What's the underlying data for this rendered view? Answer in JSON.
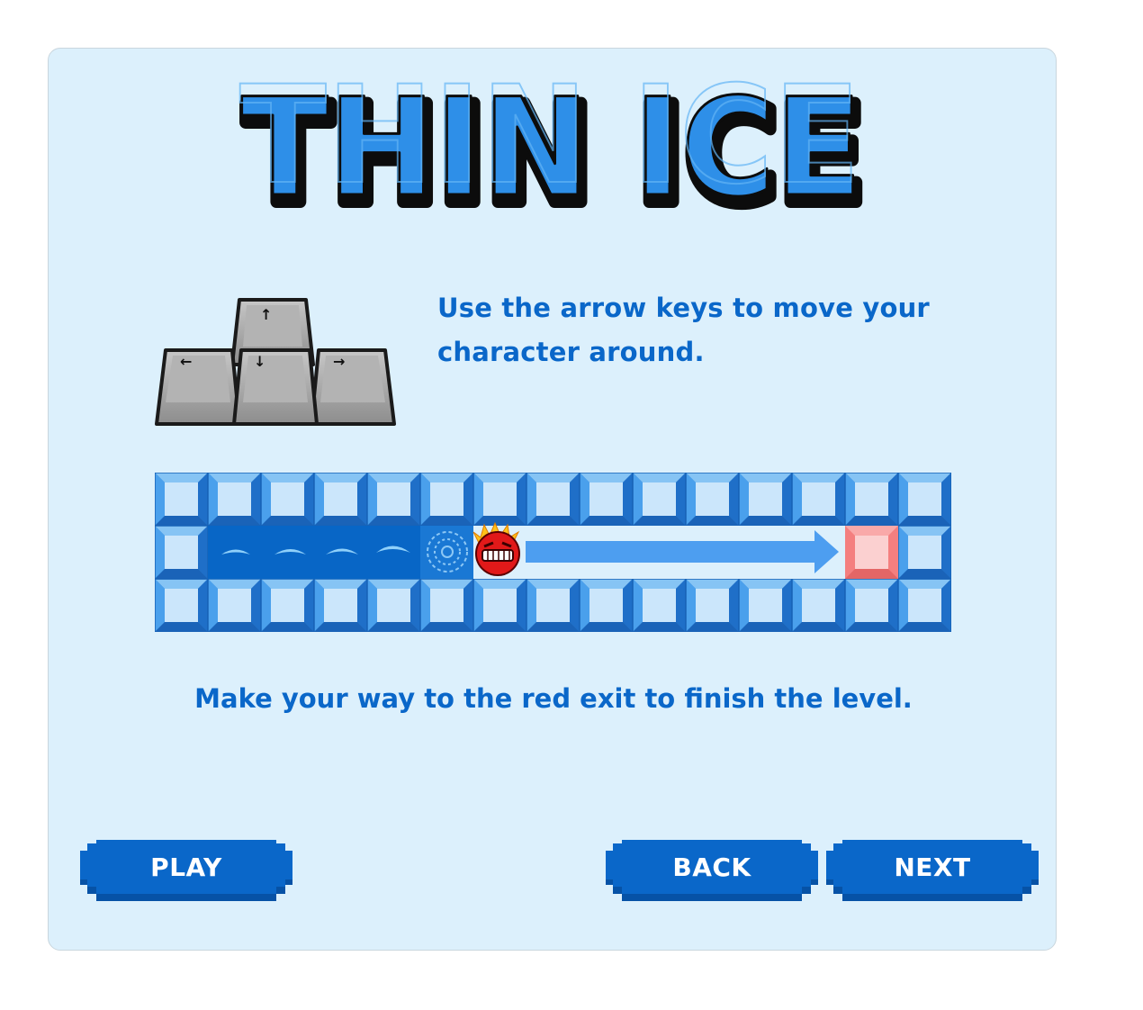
{
  "title": "THIN ICE",
  "colors": {
    "panel_bg": "#dcf0fc",
    "text_blue": "#0a67c9",
    "button_blue": "#0a67c9",
    "button_shadow": "#0652a6",
    "ice_blue": "#3b8fe6",
    "water_blue": "#0866c6",
    "exit_red": "#f47f7f"
  },
  "keys_icon": "arrow-keys-icon",
  "instructions": {
    "line1": "Use the arrow keys to move your character around.",
    "line2": "Make your way to the red exit to finish the level."
  },
  "board": {
    "character_icon": "puffle-icon",
    "exit_icon": "red-exit-tile-icon",
    "arrow_icon": "right-arrow-icon"
  },
  "buttons": {
    "play": "PLAY",
    "back": "BACK",
    "next": "NEXT"
  }
}
